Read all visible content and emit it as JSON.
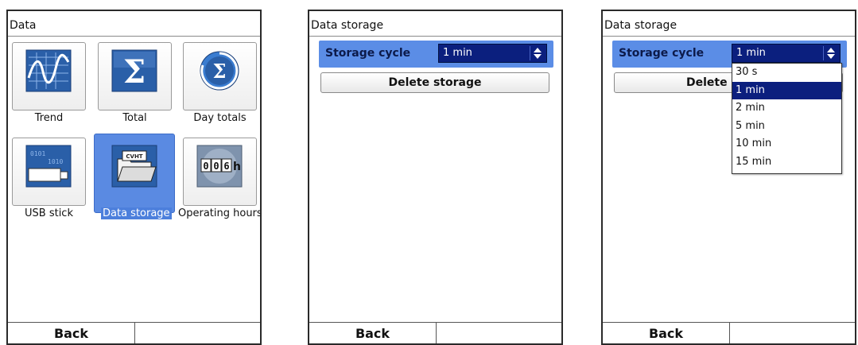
{
  "screen1": {
    "title": "Data",
    "tiles": [
      {
        "label": "Trend",
        "icon": "trend-icon"
      },
      {
        "label": "Total",
        "icon": "sigma-icon"
      },
      {
        "label": "Day totals",
        "icon": "day-totals-icon"
      },
      {
        "label": "USB stick",
        "icon": "usb-stick-icon"
      },
      {
        "label": "Data storage",
        "icon": "data-storage-icon"
      },
      {
        "label": "Operating hours",
        "icon": "operating-hours-icon"
      }
    ],
    "selected_tile": "Data storage",
    "counter_text": "00",
    "counter_unit": "h",
    "back_label": "Back"
  },
  "screen2": {
    "title": "Data storage",
    "storage_cycle_label": "Storage cycle",
    "storage_cycle_value": "1 min",
    "delete_label": "Delete storage",
    "back_label": "Back"
  },
  "screen3": {
    "title": "Data storage",
    "storage_cycle_label": "Storage cycle",
    "storage_cycle_value": "1 min",
    "delete_label_visible": "Delete s",
    "options": [
      "30 s",
      "1 min",
      "2 min",
      "5 min",
      "10 min",
      "15 min"
    ],
    "selected_option": "1 min",
    "back_label": "Back"
  },
  "colors": {
    "highlight": "#5b8de6",
    "select_bg": "#0b1f7e",
    "icon_blue": "#2a5fa8"
  }
}
